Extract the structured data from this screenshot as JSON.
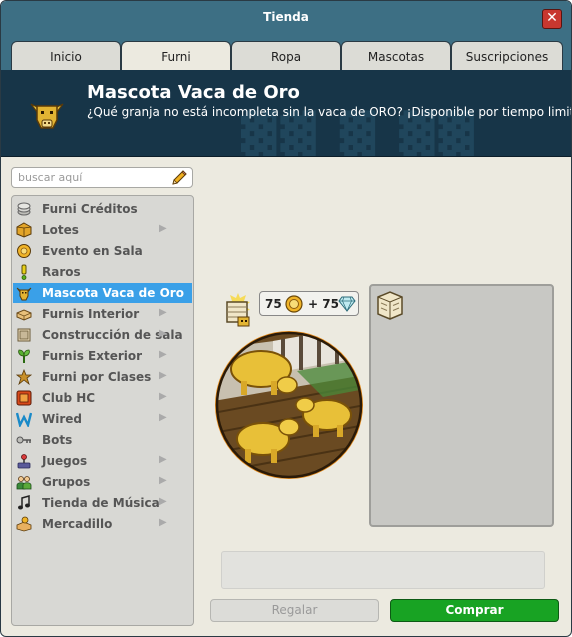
{
  "window": {
    "title": "Tienda",
    "close_glyph": "✕"
  },
  "tabs": [
    {
      "label": "Inicio"
    },
    {
      "label": "Furni"
    },
    {
      "label": "Ropa"
    },
    {
      "label": "Mascotas"
    },
    {
      "label": "Suscripciones"
    }
  ],
  "active_tab": "Furni",
  "banner": {
    "title": "Mascota Vaca de Oro",
    "description": "¿Qué granja no está incompleta sin la vaca de ORO? ¡Disponible por tiempo limitado!",
    "icon": "golden-cow-icon"
  },
  "search": {
    "placeholder": "buscar aquí",
    "icon": "pencil-icon"
  },
  "categories": [
    {
      "label": "Furni Créditos",
      "icon": "coins-stack-icon",
      "has_submenu": false
    },
    {
      "label": "Lotes",
      "icon": "bundle-box-icon",
      "has_submenu": true
    },
    {
      "label": "Evento en Sala",
      "icon": "event-coin-icon",
      "has_submenu": false
    },
    {
      "label": "Raros",
      "icon": "exclamation-icon",
      "has_submenu": false
    },
    {
      "label": "Mascota Vaca de Oro",
      "icon": "golden-cow-icon",
      "has_submenu": false,
      "selected": true
    },
    {
      "label": "Furnis Interior",
      "icon": "sofa-icon",
      "has_submenu": true
    },
    {
      "label": "Construcción de sala",
      "icon": "wall-block-icon",
      "has_submenu": true
    },
    {
      "label": "Furnis Exterior",
      "icon": "plant-icon",
      "has_submenu": true
    },
    {
      "label": "Furni por Clases",
      "icon": "star-icon",
      "has_submenu": true
    },
    {
      "label": "Club HC",
      "icon": "hc-badge-icon",
      "has_submenu": true
    },
    {
      "label": "Wired",
      "icon": "wired-icon",
      "has_submenu": true
    },
    {
      "label": "Bots",
      "icon": "key-icon",
      "has_submenu": false
    },
    {
      "label": "Juegos",
      "icon": "joystick-icon",
      "has_submenu": true
    },
    {
      "label": "Grupos",
      "icon": "group-icon",
      "has_submenu": true
    },
    {
      "label": "Tienda de Música",
      "icon": "music-note-icon",
      "has_submenu": true
    },
    {
      "label": "Mercadillo",
      "icon": "market-icon",
      "has_submenu": true
    }
  ],
  "chevron_glyph": "▶",
  "product": {
    "price_credits": "75",
    "price_separator": "+",
    "price_diamonds": "75",
    "credit_icon": "gold-coin-icon",
    "diamond_icon": "diamond-icon"
  },
  "buttons": {
    "gift": "Regalar",
    "buy": "Comprar"
  },
  "colors": {
    "title_bar": "#3d6f84",
    "banner": "#173548",
    "selected_item": "#3aa0e8",
    "buy_button": "#18a323"
  }
}
